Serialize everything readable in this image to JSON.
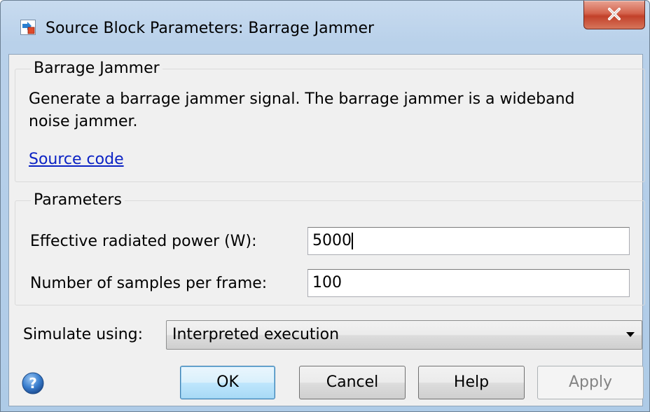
{
  "window": {
    "title": "Source Block Parameters: Barrage Jammer",
    "close_label": "X"
  },
  "description": {
    "group_title": "Barrage Jammer",
    "text": "Generate a barrage jammer signal. The barrage jammer is a wideband noise jammer.",
    "link": "Source code"
  },
  "parameters": {
    "group_title": "Parameters",
    "fields": [
      {
        "label": "Effective radiated power (W):",
        "value": "5000"
      },
      {
        "label": "Number of samples per frame:",
        "value": "100"
      }
    ]
  },
  "simulate": {
    "label": "Simulate using:",
    "selected": "Interpreted execution"
  },
  "buttons": {
    "ok": "OK",
    "cancel": "Cancel",
    "help": "Help",
    "apply": "Apply"
  },
  "icons": {
    "app": "simulink-block-icon",
    "help": "help-question-icon",
    "close": "close-icon",
    "dropdown": "chevron-down-icon"
  },
  "colors": {
    "link": "#0b22c4",
    "close_button": "#c2412a",
    "ok_button": "#bee6fd"
  }
}
